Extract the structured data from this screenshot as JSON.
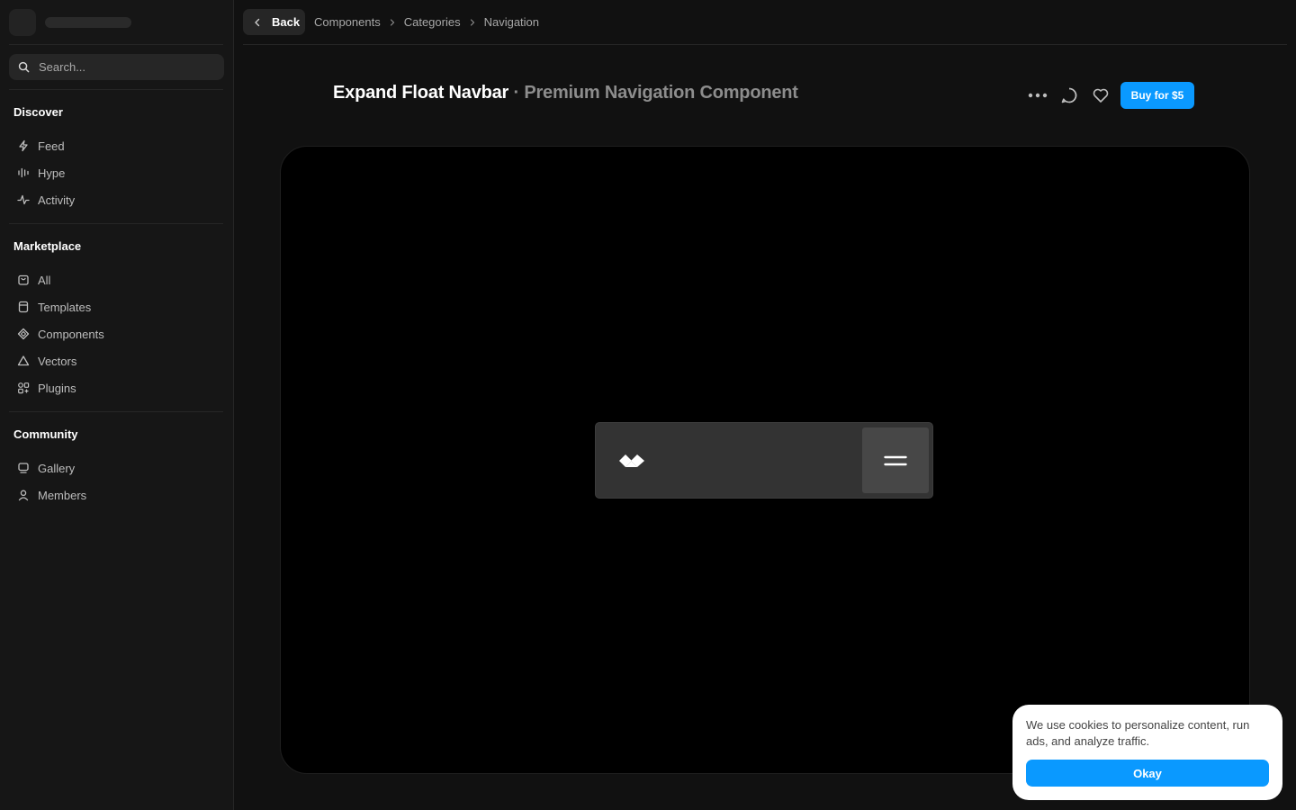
{
  "sidebar": {
    "search": {
      "placeholder": "Search..."
    },
    "sections": {
      "discover": {
        "title": "Discover",
        "items": [
          {
            "label": "Feed",
            "icon": "bolt-icon"
          },
          {
            "label": "Hype",
            "icon": "bars-icon"
          },
          {
            "label": "Activity",
            "icon": "pulse-icon"
          }
        ]
      },
      "marketplace": {
        "title": "Marketplace",
        "items": [
          {
            "label": "All",
            "icon": "bag-icon"
          },
          {
            "label": "Templates",
            "icon": "template-icon"
          },
          {
            "label": "Components",
            "icon": "diamond-icon"
          },
          {
            "label": "Vectors",
            "icon": "triangle-icon"
          },
          {
            "label": "Plugins",
            "icon": "plugins-icon"
          }
        ]
      },
      "community": {
        "title": "Community",
        "items": [
          {
            "label": "Gallery",
            "icon": "gallery-icon"
          },
          {
            "label": "Members",
            "icon": "user-icon"
          }
        ]
      }
    }
  },
  "topbar": {
    "back_label": "Back",
    "breadcrumbs": [
      "Components",
      "Categories",
      "Navigation"
    ]
  },
  "page": {
    "title": "Expand Float Navbar",
    "separator": "·",
    "subtitle": "Premium Navigation Component",
    "buy_label": "Buy for $5"
  },
  "cookie": {
    "text": "We use cookies to personalize content, run ads, and analyze traffic.",
    "button_label": "Okay"
  },
  "colors": {
    "accent": "#0a99ff",
    "background": "#111111",
    "sidebar": "#161616"
  }
}
